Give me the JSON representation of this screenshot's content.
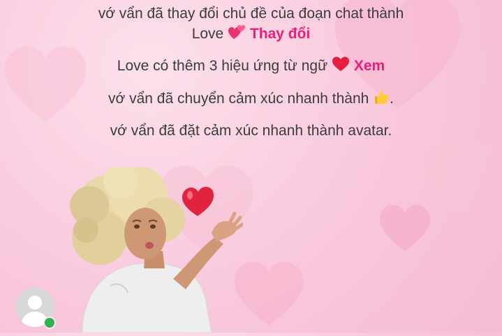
{
  "theme_message": {
    "line1": "vớ vẩn đã thay đổi chủ đề của đoạn chat thành",
    "line2_prefix": "Love",
    "line2_emoji": "💕",
    "action": "Thay đổi"
  },
  "effects_message": {
    "text": "Love có thêm 3 hiệu ứng từ ngữ",
    "emoji": "❤️",
    "action": "Xem"
  },
  "quick_reaction_message": {
    "text": "vớ vẩn đã chuyển cảm xúc nhanh thành",
    "emoji": "👍",
    "suffix": "."
  },
  "avatar_reaction_message": {
    "text": "vớ vẩn đã đặt cảm xúc nhanh thành avatar."
  },
  "colors": {
    "accent": "#e91e78",
    "background": "#f9c8dc",
    "online": "#31b34f"
  },
  "icons": [
    "two-hearts-icon",
    "red-heart-icon",
    "thumbs-up-icon",
    "default-avatar-icon",
    "online-status-icon"
  ]
}
